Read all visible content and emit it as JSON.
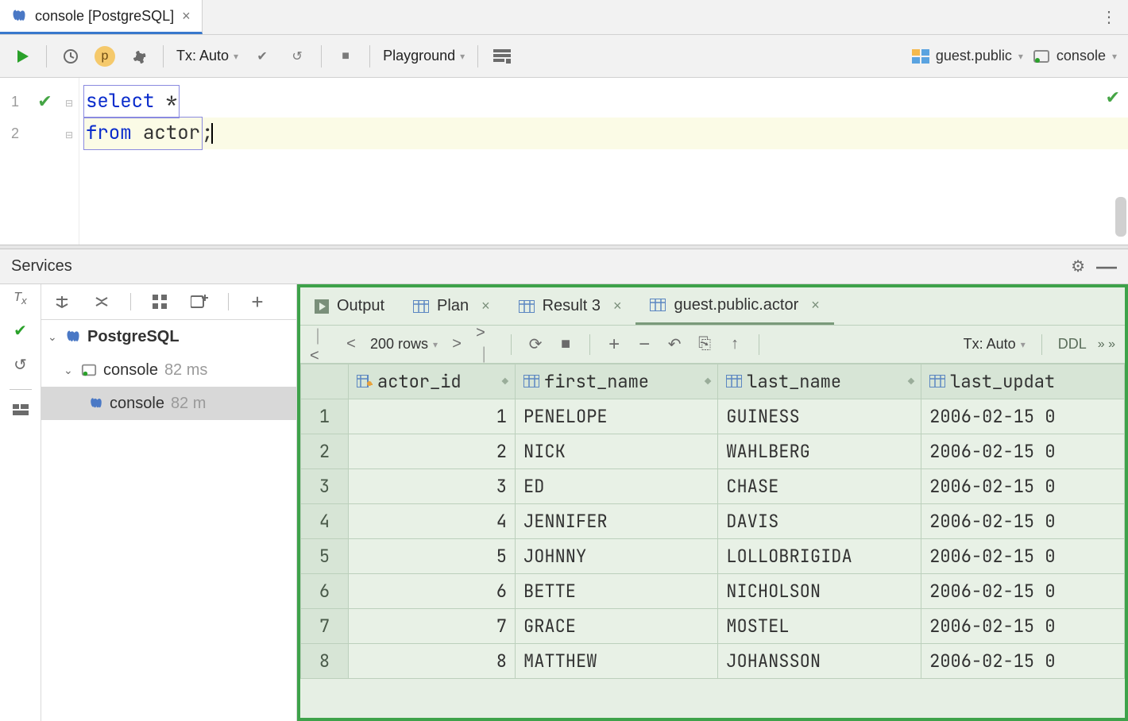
{
  "file_tab": {
    "label": "console [PostgreSQL]"
  },
  "query_toolbar": {
    "play_badge": "p",
    "tx_label": "Tx: Auto",
    "playground_label": "Playground",
    "schema_label": "guest.public",
    "console_label": "console"
  },
  "editor": {
    "line1_kw": "select",
    "line1_rest": " *",
    "line2_kw": "from",
    "line2_rest": " actor",
    "line2_tail": ";",
    "gutter": [
      "1",
      "2"
    ]
  },
  "services": {
    "title": "Services",
    "tree": {
      "root": "PostgreSQL",
      "console": "console",
      "console_ms": "82 ms",
      "leaf": "console",
      "leaf_ms": "82 m"
    }
  },
  "result_tabs": {
    "output": "Output",
    "plan": "Plan",
    "result": "Result 3",
    "actor": "guest.public.actor"
  },
  "result_toolbar": {
    "row_count": "200 rows",
    "tx": "Tx: Auto",
    "ddl": "DDL"
  },
  "grid": {
    "columns": [
      "actor_id",
      "first_name",
      "last_name",
      "last_updat"
    ],
    "rows": [
      {
        "n": "1",
        "actor_id": "1",
        "first_name": "PENELOPE",
        "last_name": "GUINESS",
        "last_update": "2006-02-15 0"
      },
      {
        "n": "2",
        "actor_id": "2",
        "first_name": "NICK",
        "last_name": "WAHLBERG",
        "last_update": "2006-02-15 0"
      },
      {
        "n": "3",
        "actor_id": "3",
        "first_name": "ED",
        "last_name": "CHASE",
        "last_update": "2006-02-15 0"
      },
      {
        "n": "4",
        "actor_id": "4",
        "first_name": "JENNIFER",
        "last_name": "DAVIS",
        "last_update": "2006-02-15 0"
      },
      {
        "n": "5",
        "actor_id": "5",
        "first_name": "JOHNNY",
        "last_name": "LOLLOBRIGIDA",
        "last_update": "2006-02-15 0"
      },
      {
        "n": "6",
        "actor_id": "6",
        "first_name": "BETTE",
        "last_name": "NICHOLSON",
        "last_update": "2006-02-15 0"
      },
      {
        "n": "7",
        "actor_id": "7",
        "first_name": "GRACE",
        "last_name": "MOSTEL",
        "last_update": "2006-02-15 0"
      },
      {
        "n": "8",
        "actor_id": "8",
        "first_name": "MATTHEW",
        "last_name": "JOHANSSON",
        "last_update": "2006-02-15 0"
      }
    ]
  }
}
